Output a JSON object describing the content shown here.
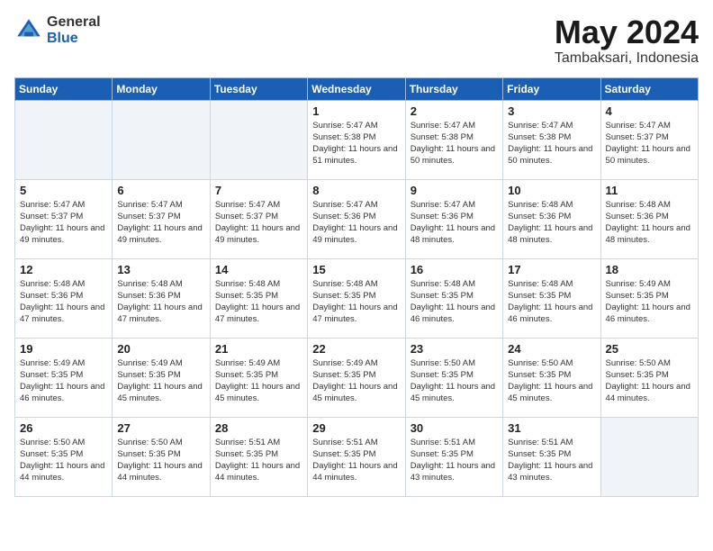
{
  "logo": {
    "general": "General",
    "blue": "Blue"
  },
  "title": "May 2024",
  "subtitle": "Tambaksari, Indonesia",
  "days_of_week": [
    "Sunday",
    "Monday",
    "Tuesday",
    "Wednesday",
    "Thursday",
    "Friday",
    "Saturday"
  ],
  "weeks": [
    [
      {
        "day": "",
        "empty": true
      },
      {
        "day": "",
        "empty": true
      },
      {
        "day": "",
        "empty": true
      },
      {
        "day": "1",
        "sunrise": "5:47 AM",
        "sunset": "5:38 PM",
        "daylight": "11 hours and 51 minutes."
      },
      {
        "day": "2",
        "sunrise": "5:47 AM",
        "sunset": "5:38 PM",
        "daylight": "11 hours and 50 minutes."
      },
      {
        "day": "3",
        "sunrise": "5:47 AM",
        "sunset": "5:38 PM",
        "daylight": "11 hours and 50 minutes."
      },
      {
        "day": "4",
        "sunrise": "5:47 AM",
        "sunset": "5:37 PM",
        "daylight": "11 hours and 50 minutes."
      }
    ],
    [
      {
        "day": "5",
        "sunrise": "5:47 AM",
        "sunset": "5:37 PM",
        "daylight": "11 hours and 49 minutes."
      },
      {
        "day": "6",
        "sunrise": "5:47 AM",
        "sunset": "5:37 PM",
        "daylight": "11 hours and 49 minutes."
      },
      {
        "day": "7",
        "sunrise": "5:47 AM",
        "sunset": "5:37 PM",
        "daylight": "11 hours and 49 minutes."
      },
      {
        "day": "8",
        "sunrise": "5:47 AM",
        "sunset": "5:36 PM",
        "daylight": "11 hours and 49 minutes."
      },
      {
        "day": "9",
        "sunrise": "5:47 AM",
        "sunset": "5:36 PM",
        "daylight": "11 hours and 48 minutes."
      },
      {
        "day": "10",
        "sunrise": "5:48 AM",
        "sunset": "5:36 PM",
        "daylight": "11 hours and 48 minutes."
      },
      {
        "day": "11",
        "sunrise": "5:48 AM",
        "sunset": "5:36 PM",
        "daylight": "11 hours and 48 minutes."
      }
    ],
    [
      {
        "day": "12",
        "sunrise": "5:48 AM",
        "sunset": "5:36 PM",
        "daylight": "11 hours and 47 minutes."
      },
      {
        "day": "13",
        "sunrise": "5:48 AM",
        "sunset": "5:36 PM",
        "daylight": "11 hours and 47 minutes."
      },
      {
        "day": "14",
        "sunrise": "5:48 AM",
        "sunset": "5:35 PM",
        "daylight": "11 hours and 47 minutes."
      },
      {
        "day": "15",
        "sunrise": "5:48 AM",
        "sunset": "5:35 PM",
        "daylight": "11 hours and 47 minutes."
      },
      {
        "day": "16",
        "sunrise": "5:48 AM",
        "sunset": "5:35 PM",
        "daylight": "11 hours and 46 minutes."
      },
      {
        "day": "17",
        "sunrise": "5:48 AM",
        "sunset": "5:35 PM",
        "daylight": "11 hours and 46 minutes."
      },
      {
        "day": "18",
        "sunrise": "5:49 AM",
        "sunset": "5:35 PM",
        "daylight": "11 hours and 46 minutes."
      }
    ],
    [
      {
        "day": "19",
        "sunrise": "5:49 AM",
        "sunset": "5:35 PM",
        "daylight": "11 hours and 46 minutes."
      },
      {
        "day": "20",
        "sunrise": "5:49 AM",
        "sunset": "5:35 PM",
        "daylight": "11 hours and 45 minutes."
      },
      {
        "day": "21",
        "sunrise": "5:49 AM",
        "sunset": "5:35 PM",
        "daylight": "11 hours and 45 minutes."
      },
      {
        "day": "22",
        "sunrise": "5:49 AM",
        "sunset": "5:35 PM",
        "daylight": "11 hours and 45 minutes."
      },
      {
        "day": "23",
        "sunrise": "5:50 AM",
        "sunset": "5:35 PM",
        "daylight": "11 hours and 45 minutes."
      },
      {
        "day": "24",
        "sunrise": "5:50 AM",
        "sunset": "5:35 PM",
        "daylight": "11 hours and 45 minutes."
      },
      {
        "day": "25",
        "sunrise": "5:50 AM",
        "sunset": "5:35 PM",
        "daylight": "11 hours and 44 minutes."
      }
    ],
    [
      {
        "day": "26",
        "sunrise": "5:50 AM",
        "sunset": "5:35 PM",
        "daylight": "11 hours and 44 minutes."
      },
      {
        "day": "27",
        "sunrise": "5:50 AM",
        "sunset": "5:35 PM",
        "daylight": "11 hours and 44 minutes."
      },
      {
        "day": "28",
        "sunrise": "5:51 AM",
        "sunset": "5:35 PM",
        "daylight": "11 hours and 44 minutes."
      },
      {
        "day": "29",
        "sunrise": "5:51 AM",
        "sunset": "5:35 PM",
        "daylight": "11 hours and 44 minutes."
      },
      {
        "day": "30",
        "sunrise": "5:51 AM",
        "sunset": "5:35 PM",
        "daylight": "11 hours and 43 minutes."
      },
      {
        "day": "31",
        "sunrise": "5:51 AM",
        "sunset": "5:35 PM",
        "daylight": "11 hours and 43 minutes."
      },
      {
        "day": "",
        "empty": true
      }
    ]
  ],
  "labels": {
    "sunrise": "Sunrise:",
    "sunset": "Sunset:",
    "daylight": "Daylight:"
  }
}
